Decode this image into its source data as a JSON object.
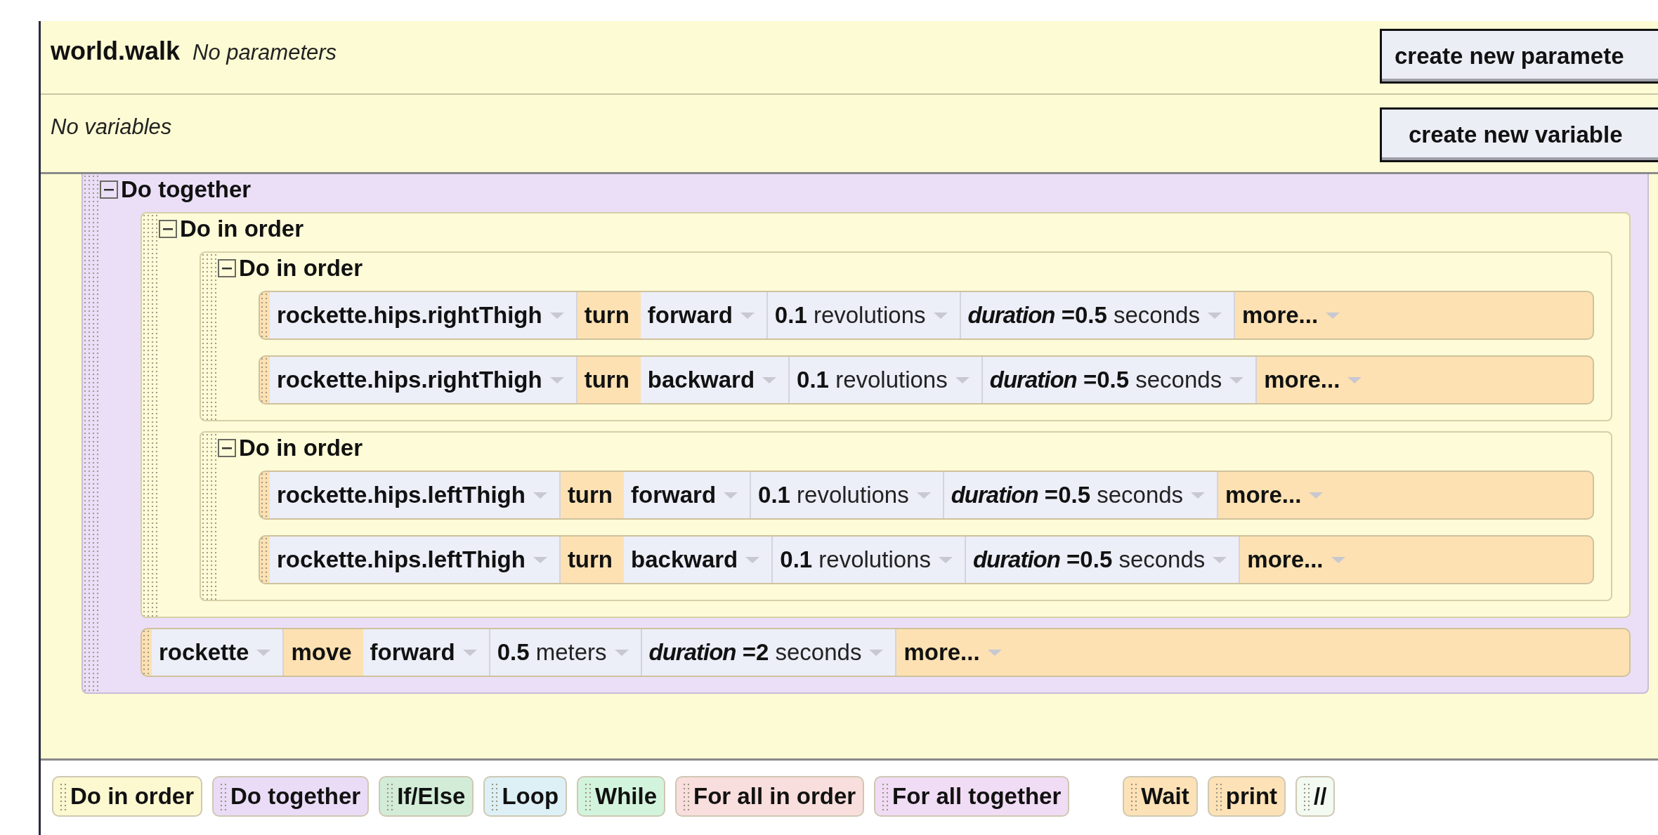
{
  "method": {
    "name": "world.walk",
    "parameters_label": "No parameters"
  },
  "variables_label": "No variables",
  "buttons": [
    {
      "label": "create new paramete"
    },
    {
      "label": "create new variable"
    }
  ],
  "program": {
    "kind": "do_together",
    "label": "Do together",
    "expanded": true,
    "children": [
      {
        "kind": "do_in_order",
        "label": "Do in order",
        "expanded": true,
        "children": [
          {
            "kind": "do_in_order",
            "label": "Do in order",
            "expanded": true,
            "children": [
              {
                "kind": "statement",
                "object": "rockette.hips.rightThigh",
                "verb": "turn",
                "direction": "forward",
                "amount": "0.1",
                "unit": "revolutions",
                "param_name": "duration",
                "equals": "=",
                "param_value": "0.5",
                "param_unit": "seconds",
                "more": "more..."
              },
              {
                "kind": "statement",
                "object": "rockette.hips.rightThigh",
                "verb": "turn",
                "direction": "backward",
                "amount": "0.1",
                "unit": "revolutions",
                "param_name": "duration",
                "equals": "=",
                "param_value": "0.5",
                "param_unit": "seconds",
                "more": "more..."
              }
            ]
          },
          {
            "kind": "do_in_order",
            "label": "Do in order",
            "expanded": true,
            "children": [
              {
                "kind": "statement",
                "object": "rockette.hips.leftThigh",
                "verb": "turn",
                "direction": "forward",
                "amount": "0.1",
                "unit": "revolutions",
                "param_name": "duration",
                "equals": "=",
                "param_value": "0.5",
                "param_unit": "seconds",
                "more": "more..."
              },
              {
                "kind": "statement",
                "object": "rockette.hips.leftThigh",
                "verb": "turn",
                "direction": "backward",
                "amount": "0.1",
                "unit": "revolutions",
                "param_name": "duration",
                "equals": "=",
                "param_value": "0.5",
                "param_unit": "seconds",
                "more": "more..."
              }
            ]
          }
        ]
      },
      {
        "kind": "statement",
        "object": "rockette",
        "verb": "move",
        "direction": "forward",
        "amount": "0.5",
        "unit": "meters",
        "param_name": "duration",
        "equals": "=",
        "param_value": "2",
        "param_unit": "seconds",
        "more": "more..."
      }
    ]
  },
  "palette": {
    "control": [
      {
        "label": "Do in order",
        "color": "#fcf8d0"
      },
      {
        "label": "Do together",
        "color": "#eadcf6"
      },
      {
        "label": "If/Else",
        "color": "#d2ecd8"
      },
      {
        "label": "Loop",
        "color": "#dcf0f6"
      },
      {
        "label": "While",
        "color": "#d2f4dc"
      },
      {
        "label": "For all in order",
        "color": "#f8dedc"
      },
      {
        "label": "For all together",
        "color": "#f0dcf4"
      }
    ],
    "statements": [
      {
        "label": "Wait",
        "color": "#fce2b6"
      },
      {
        "label": "print",
        "color": "#fce2b6"
      },
      {
        "label": "//",
        "color": "#f2faf2"
      }
    ]
  }
}
